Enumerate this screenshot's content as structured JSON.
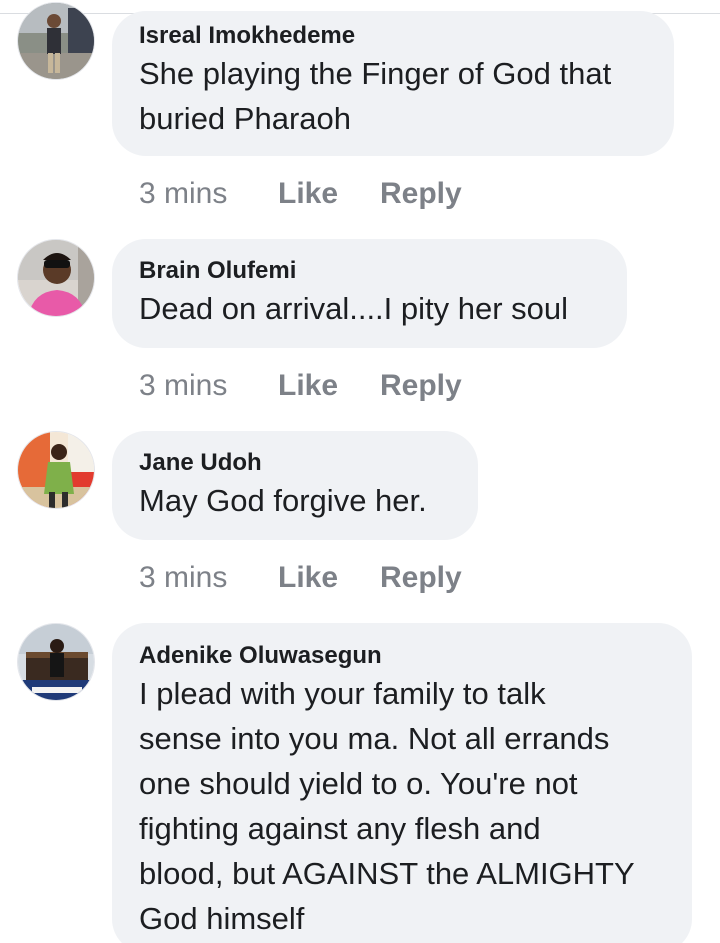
{
  "comments": [
    {
      "author": "Isreal Imokhedeme",
      "lines": [
        "She playing the Finger of God that",
        "buried Pharaoh"
      ],
      "time": "3 mins",
      "like_label": "Like",
      "reply_label": "Reply"
    },
    {
      "author": "Brain Olufemi",
      "lines": [
        "Dead on arrival....I pity her soul"
      ],
      "time": "3 mins",
      "like_label": "Like",
      "reply_label": "Reply"
    },
    {
      "author": "Jane Udoh",
      "lines": [
        "May God forgive her."
      ],
      "time": "3 mins",
      "like_label": "Like",
      "reply_label": "Reply"
    },
    {
      "author": "Adenike Oluwasegun",
      "lines": [
        "I plead with your family to talk",
        "sense into you ma. Not all errands",
        "one should yield to o. You're not",
        "fighting against any flesh and",
        "blood, but AGAINST the ALMIGHTY",
        "God himself"
      ]
    }
  ],
  "colors": {
    "bubble_bg": "#f0f2f5",
    "text": "#1c1e21",
    "meta": "#7d8188"
  }
}
